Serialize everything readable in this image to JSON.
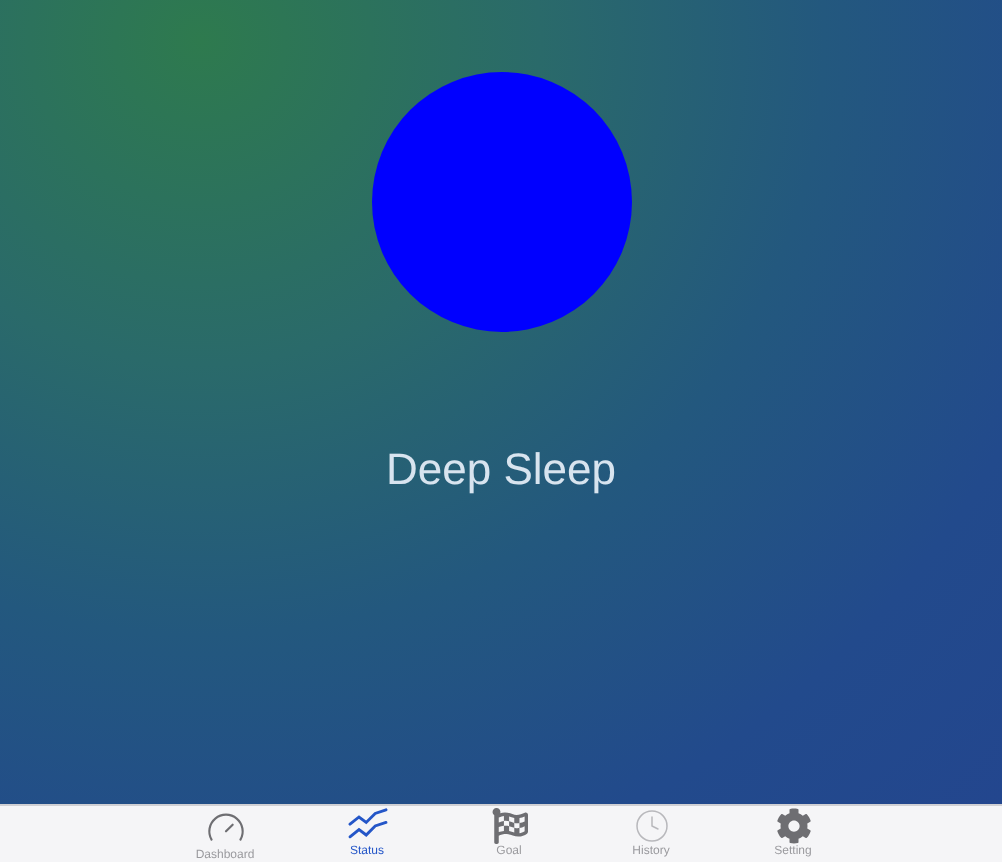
{
  "indicator": {
    "color": "#0000ff"
  },
  "state_label": "Deep Sleep",
  "tabs": [
    {
      "kind": "dashboard",
      "label": "Dashboard",
      "selected": false
    },
    {
      "kind": "status",
      "label": "Status",
      "selected": true
    },
    {
      "kind": "goal",
      "label": "Goal",
      "selected": false
    },
    {
      "kind": "history",
      "label": "History",
      "selected": false
    },
    {
      "kind": "setting",
      "label": "Setting",
      "selected": false
    }
  ]
}
